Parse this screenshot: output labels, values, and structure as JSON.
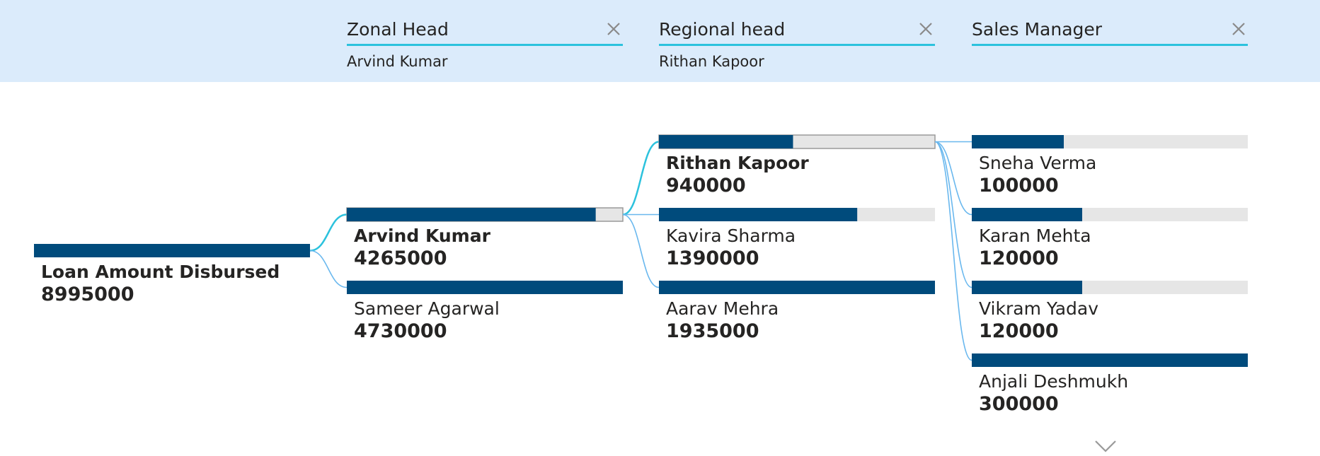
{
  "levels": [
    {
      "title": "Zonal Head",
      "filter": "Arvind Kumar"
    },
    {
      "title": "Regional head",
      "filter": "Rithan Kapoor"
    },
    {
      "title": "Sales Manager",
      "filter": ""
    }
  ],
  "colors": {
    "header_bg": "#dbebfb",
    "bar_fill": "#004b7c",
    "bar_track": "#e6e6e6",
    "accent": "#2cc2dd",
    "connector": "#6ab8ee",
    "connector_active": "#2cc2dd"
  },
  "icons": {
    "close": "close-icon",
    "expand": "chevron-down-icon"
  },
  "chart_data": {
    "type": "decomposition-tree",
    "root": {
      "label": "Loan Amount Disbursed",
      "value": 8995000
    },
    "levels": [
      {
        "name": "Zonal Head",
        "expanded": "Arvind Kumar",
        "nodes": [
          {
            "label": "Arvind Kumar",
            "value": 4265000
          },
          {
            "label": "Sameer Agarwal",
            "value": 4730000
          }
        ]
      },
      {
        "name": "Regional head",
        "expanded": "Rithan Kapoor",
        "nodes": [
          {
            "label": "Rithan Kapoor",
            "value": 940000
          },
          {
            "label": "Kavira Sharma",
            "value": 1390000
          },
          {
            "label": "Aarav Mehra",
            "value": 1935000
          }
        ]
      },
      {
        "name": "Sales Manager",
        "expanded": "",
        "nodes": [
          {
            "label": "Sneha Verma",
            "value": 100000
          },
          {
            "label": "Karan Mehta",
            "value": 120000
          },
          {
            "label": "Vikram Yadav",
            "value": 120000
          },
          {
            "label": "Anjali Deshmukh",
            "value": 300000
          }
        ]
      }
    ]
  }
}
